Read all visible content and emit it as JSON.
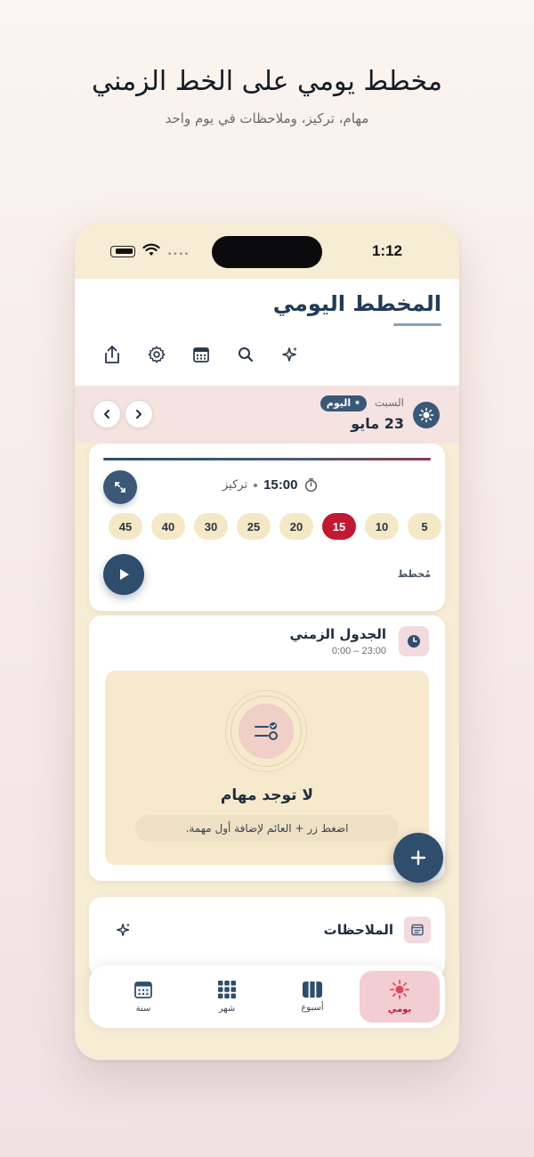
{
  "hero": {
    "title": "مخطط يومي على الخط الزمني",
    "subtitle": "مهام، تركيز، وملاحظات في يوم واحد"
  },
  "status_bar": {
    "time": "1:12",
    "icons": [
      "battery-icon",
      "wifi-icon",
      "signal-icon"
    ]
  },
  "header": {
    "title": "المخطط اليومي",
    "toolbar": [
      "sparkle-icon",
      "search-icon",
      "calendar-icon",
      "gear-icon",
      "share-icon"
    ]
  },
  "date_bar": {
    "day_name": "السبت",
    "today_badge": "• اليوم",
    "date": "23 مايو"
  },
  "focus": {
    "time": "15:00",
    "label": "تركيز",
    "chips": [
      "5",
      "10",
      "15",
      "20",
      "25",
      "30",
      "40",
      "45"
    ],
    "selected_chip": "15",
    "plan_label": "مُخطط"
  },
  "timeline": {
    "title": "الجدول الزمني",
    "range": "0:00 – 23:00",
    "empty_title": "لا توجد مهام",
    "empty_hint": "اضغط زر + العائم لإضافة أول مهمة."
  },
  "notes": {
    "title": "الملاحظات"
  },
  "bottom_nav": {
    "items": [
      {
        "label": "يومي",
        "icon": "sun-icon",
        "active": true
      },
      {
        "label": "أسبوع",
        "icon": "week-columns-icon",
        "active": false
      },
      {
        "label": "شهر",
        "icon": "grid-icon",
        "active": false
      },
      {
        "label": "سنة",
        "icon": "calendar-icon",
        "active": false
      }
    ]
  },
  "colors": {
    "primary": "#2f4d6c",
    "accent": "#c21933",
    "cream": "#f7ecd4",
    "pink": "#f5e3e2"
  }
}
